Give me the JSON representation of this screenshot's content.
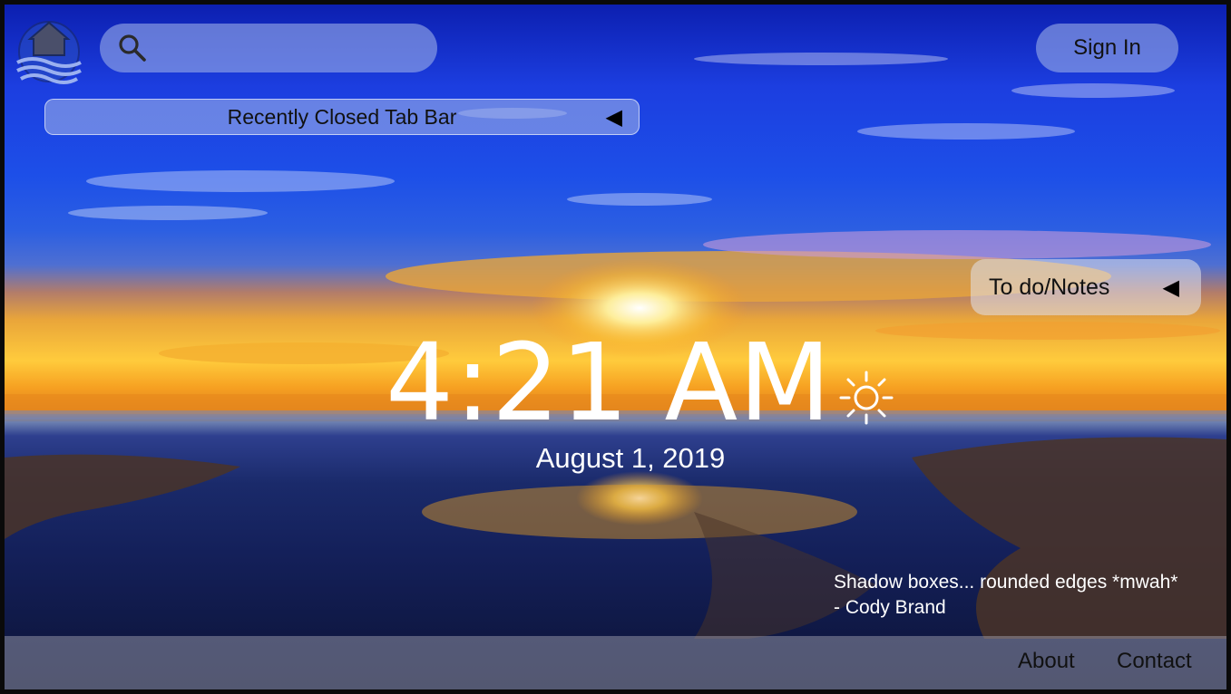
{
  "colors": {
    "sky_top": "#0c1fb0",
    "sun": "#ffcb3c",
    "panel_blue": "#96aae6",
    "panel_gray": "#e1e1eb",
    "text_dark": "#111111",
    "text_light": "#ffffff"
  },
  "header": {
    "logo_icon": "house-waves-logo-icon",
    "search": {
      "icon": "search-icon",
      "placeholder": "",
      "value": ""
    },
    "sign_in_label": "Sign In"
  },
  "recent_tabs": {
    "label": "Recently Closed Tab Bar",
    "toggle_icon": "◀"
  },
  "todo": {
    "label": "To do/Notes",
    "toggle_icon": "◀"
  },
  "clock": {
    "time": "4:21 AM",
    "date": "August 1, 2019",
    "weather_icon": "sun-icon"
  },
  "quote": {
    "text": "Shadow boxes... rounded edges *mwah*",
    "author": "- Cody Brand"
  },
  "footer": {
    "about_label": "About",
    "contact_label": "Contact"
  }
}
